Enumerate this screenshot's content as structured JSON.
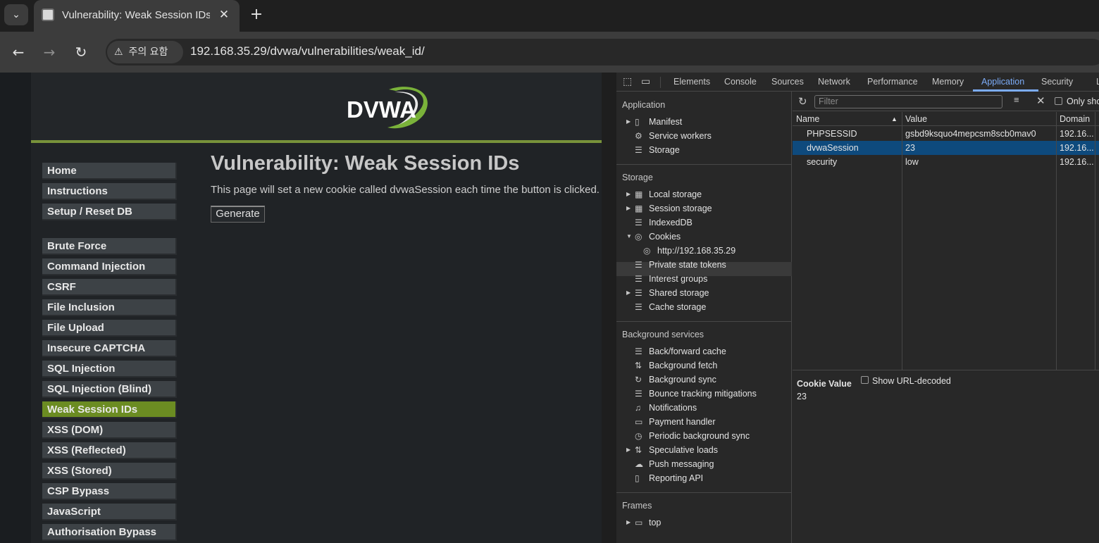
{
  "browser": {
    "tab_title": "Vulnerability: Weak Session IDs",
    "tab_list_icon": "chevron-down-icon",
    "new_tab_label": "+",
    "security_chip": "주의 요함",
    "url": "192.168.35.29/dvwa/vulnerabilities/weak_id/"
  },
  "dvwa": {
    "logo_text": "DVWA",
    "menu_group_1": [
      "Home",
      "Instructions",
      "Setup / Reset DB"
    ],
    "menu_group_2": [
      "Brute Force",
      "Command Injection",
      "CSRF",
      "File Inclusion",
      "File Upload",
      "Insecure CAPTCHA",
      "SQL Injection",
      "SQL Injection (Blind)",
      "Weak Session IDs",
      "XSS (DOM)",
      "XSS (Reflected)",
      "XSS (Stored)",
      "CSP Bypass",
      "JavaScript",
      "Authorisation Bypass"
    ],
    "active_item": "Weak Session IDs",
    "page_title": "Vulnerability: Weak Session IDs",
    "description": "This page will set a new cookie called dvwaSession each time the button is clicked.",
    "generate_button": "Generate",
    "accent_color": "#6b8c22"
  },
  "devtools": {
    "tabs": [
      "Elements",
      "Console",
      "Sources",
      "Network",
      "Performance",
      "Memory",
      "Application",
      "Security",
      "L"
    ],
    "active_tab": "Application",
    "sidebar": {
      "application_header": "Application",
      "application_items": [
        "Manifest",
        "Service workers",
        "Storage"
      ],
      "storage_header": "Storage",
      "storage_items": [
        "Local storage",
        "Session storage",
        "IndexedDB",
        "Cookies",
        "http://192.168.35.29",
        "Private state tokens",
        "Interest groups",
        "Shared storage",
        "Cache storage"
      ],
      "background_header": "Background services",
      "background_items": [
        "Back/forward cache",
        "Background fetch",
        "Background sync",
        "Bounce tracking mitigations",
        "Notifications",
        "Payment handler",
        "Periodic background sync",
        "Speculative loads",
        "Push messaging",
        "Reporting API"
      ],
      "frames_header": "Frames",
      "frames_items": [
        "top"
      ]
    },
    "filter_placeholder": "Filter",
    "only_show_label": "Only sho",
    "columns": [
      "Name",
      "Value",
      "Domain"
    ],
    "cookies": [
      {
        "name": "PHPSESSID",
        "value": "gsbd9ksquo4mepcsm8scb0mav0",
        "domain": "192.16..."
      },
      {
        "name": "dvwaSession",
        "value": "23",
        "domain": "192.16..."
      },
      {
        "name": "security",
        "value": "low",
        "domain": "192.16..."
      }
    ],
    "selected_cookie": "dvwaSession",
    "cookie_value_header": "Cookie Value",
    "show_url_decoded": "Show URL-decoded",
    "cookie_value": "23"
  }
}
